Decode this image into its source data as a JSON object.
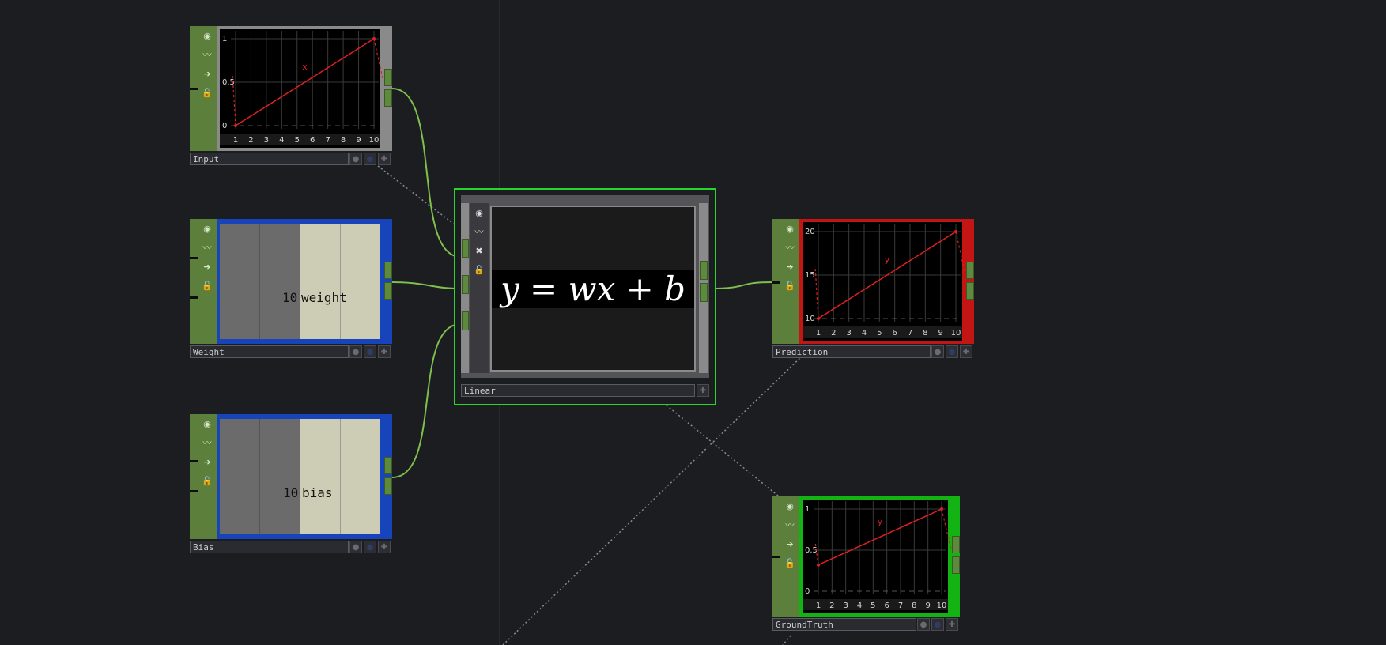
{
  "colors": {
    "background": "#1c1d21",
    "node_green": "#5c7f3c",
    "wire": "#7fbf4c",
    "selected_border": "#27d62a",
    "const_border": "#1744bb",
    "prediction_border": "#c41515",
    "groundtruth_border": "#12b312",
    "plot_line": "#e02020"
  },
  "nodes": {
    "input": {
      "name": "Input",
      "toolbar_icons": [
        "viewer-icon",
        "graph-icon",
        "arrow-icon",
        "lock-icon"
      ],
      "chart": {
        "x_ticks": [
          "1",
          "2",
          "3",
          "4",
          "5",
          "6",
          "7",
          "8",
          "9",
          "10"
        ],
        "y_ticks": [
          "0",
          "0.5",
          "1"
        ],
        "channel": "x"
      }
    },
    "weight": {
      "name": "Weight",
      "toolbar_icons": [
        "viewer-icon",
        "graph-icon",
        "arrow-icon",
        "lock-icon"
      ],
      "value": "10",
      "channel": "weight"
    },
    "bias": {
      "name": "Bias",
      "toolbar_icons": [
        "viewer-icon",
        "graph-icon",
        "arrow-icon",
        "lock-icon"
      ],
      "value": "10",
      "channel": "bias"
    },
    "linear": {
      "name": "Linear",
      "toolbar_icons": [
        "viewer-icon",
        "graph-icon",
        "close-icon",
        "lock-icon"
      ],
      "equation": "y = wx + b"
    },
    "prediction": {
      "name": "Prediction",
      "toolbar_icons": [
        "viewer-icon",
        "graph-icon",
        "arrow-icon",
        "lock-icon"
      ],
      "chart": {
        "x_ticks": [
          "1",
          "2",
          "3",
          "4",
          "5",
          "6",
          "7",
          "8",
          "9",
          "10"
        ],
        "y_ticks": [
          "10",
          "15",
          "20"
        ],
        "channel": "y"
      }
    },
    "groundtruth": {
      "name": "GroundTruth",
      "toolbar_icons": [
        "viewer-icon",
        "graph-icon",
        "arrow-icon",
        "lock-icon"
      ],
      "chart": {
        "x_ticks": [
          "1",
          "2",
          "3",
          "4",
          "5",
          "6",
          "7",
          "8",
          "9",
          "10"
        ],
        "y_ticks": [
          "0",
          "0.5",
          "1"
        ],
        "channel": "y"
      }
    }
  },
  "chart_data": [
    {
      "type": "line",
      "xlim": [
        1,
        10
      ],
      "ylim": [
        0,
        1
      ],
      "x": [
        1,
        10
      ],
      "series": [
        {
          "name": "x",
          "values": [
            0,
            1
          ]
        }
      ],
      "grid": true
    },
    {
      "type": "line",
      "xlim": [
        1,
        10
      ],
      "ylim": [
        10,
        20
      ],
      "x": [
        1,
        10
      ],
      "series": [
        {
          "name": "y",
          "values": [
            10,
            20
          ]
        }
      ],
      "grid": true
    },
    {
      "type": "line",
      "xlim": [
        1,
        10
      ],
      "ylim": [
        0,
        1
      ],
      "x": [
        1,
        10
      ],
      "series": [
        {
          "name": "y",
          "values": [
            0.32,
            1
          ]
        }
      ],
      "grid": true
    }
  ]
}
